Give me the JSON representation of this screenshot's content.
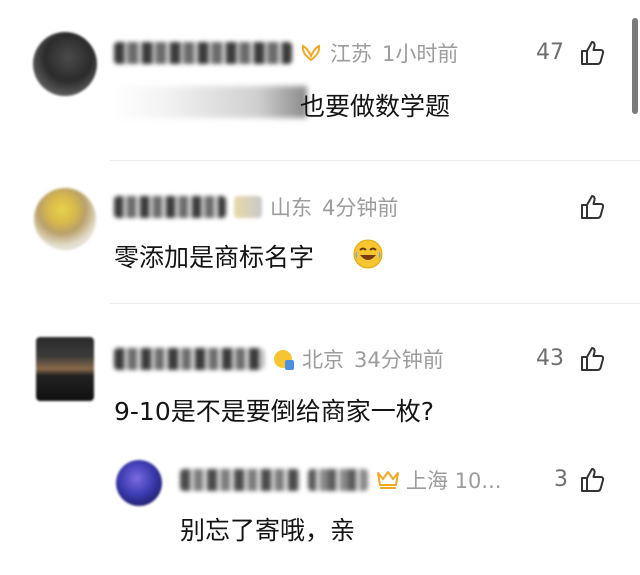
{
  "comments": [
    {
      "location": "江苏",
      "time": "1小时前",
      "likes": "47",
      "text": "也要做数学题",
      "badge_icon": "vip-wings-icon"
    },
    {
      "location": "山东",
      "time": "4分钟前",
      "likes": "",
      "text": "零添加是商标名字",
      "emoji_icon": "laughing-crying-emoji-icon"
    },
    {
      "location": "北京",
      "time": "34分钟前",
      "likes": "43",
      "text": "9-10是不是要倒给商家一枚?",
      "badge_icon": "fan-badge-icon"
    }
  ],
  "reply": {
    "location": "上海 10...",
    "likes": "3",
    "text": "别忘了寄哦，亲"
  },
  "colors": {
    "meta_gray": "#9c9c9c",
    "count_gray": "#6e6e6e",
    "badge_orange": "#f5a623"
  }
}
